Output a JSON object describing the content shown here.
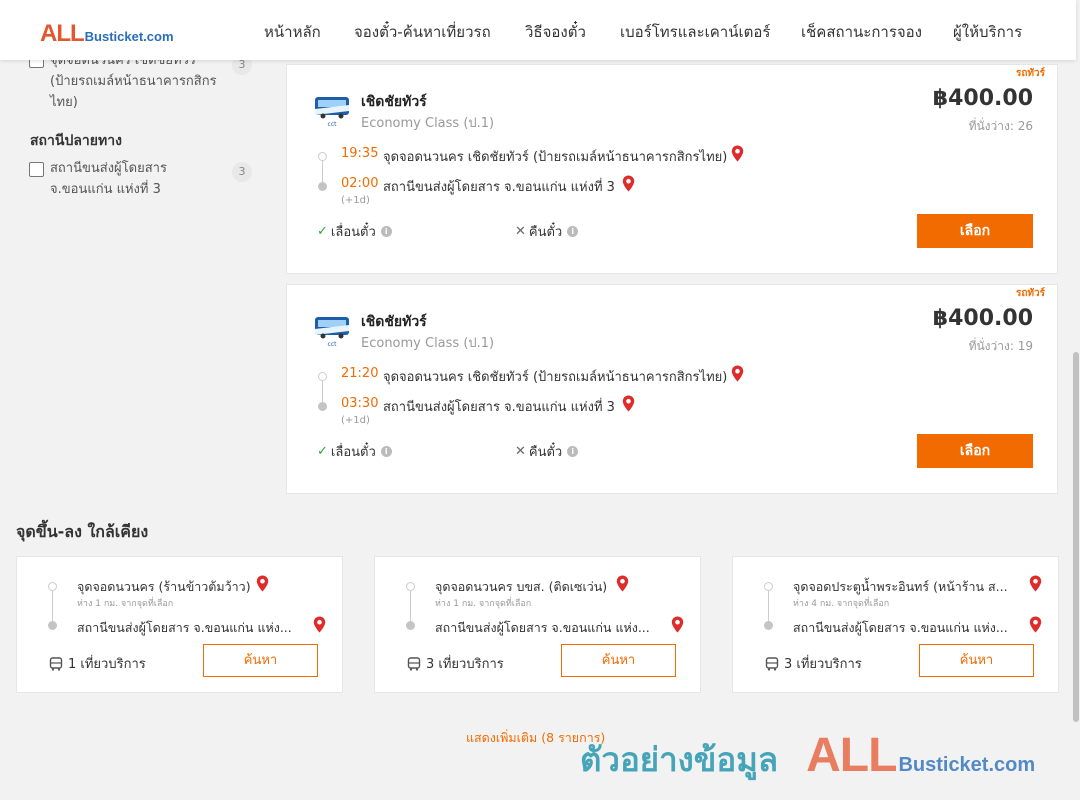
{
  "header": {
    "logo_all": "ALL",
    "logo_rest": "Busticket.com",
    "nav": [
      "หน้าหลัก",
      "จองตั๋ว-ค้นหาเที่ยวรถ",
      "วิธีจองตั๋ว",
      "เบอร์โทรและเคาน์เตอร์",
      "เช็คสถานะการจอง",
      "ผู้ให้บริการ"
    ]
  },
  "sidebar": {
    "origin_item": {
      "lines": [
        "จุดจอดนวนคร เชิดชัยทัวร์",
        "(ป้ายรถเมล์หน้าธนาคารกสิกร",
        "ไทย)"
      ],
      "count": "3"
    },
    "destination_heading": "สถานีปลายทาง",
    "destination_item": {
      "lines": [
        "สถานีขนส่งผู้โดยสาร",
        "จ.ขอนแก่น แห่งที่ 3"
      ],
      "count": "3"
    }
  },
  "results": [
    {
      "tag": "รถทัวร์",
      "operator": "เชิดชัยทัวร์",
      "bus_class": "Economy Class (ป.1)",
      "price": "฿400.00",
      "seats": "ที่นั่งว่าง: 26",
      "depart_time": "19:35",
      "depart_place": "จุดจอดนวนคร เชิดชัยทัวร์ (ป้ายรถเมล์หน้าธนาคารกสิกรไทย)",
      "arrive_time": "02:00",
      "arrive_place": "สถานีขนส่งผู้โดยสาร จ.ขอนแก่น แห่งที่ 3",
      "next_day": "(+1d)",
      "reschedule": "เลื่อนตั๋ว",
      "refund": "คืนตั๋ว",
      "select_label": "เลือก"
    },
    {
      "tag": "รถทัวร์",
      "operator": "เชิดชัยทัวร์",
      "bus_class": "Economy Class (ป.1)",
      "price": "฿400.00",
      "seats": "ที่นั่งว่าง: 19",
      "depart_time": "21:20",
      "depart_place": "จุดจอดนวนคร เชิดชัยทัวร์ (ป้ายรถเมล์หน้าธนาคารกสิกรไทย)",
      "arrive_time": "03:30",
      "arrive_place": "สถานีขนส่งผู้โดยสาร จ.ขอนแก่น แห่งที่ 3",
      "next_day": "(+1d)",
      "reschedule": "เลื่อนตั๋ว",
      "refund": "คืนตั๋ว",
      "select_label": "เลือก"
    }
  ],
  "nearby": {
    "title": "จุดขึ้น-ลง ใกล้เคียง",
    "items": [
      {
        "name": "จุดจอดนวนคร (ร้านข้าวต้มว้าว)",
        "distance": "ห่าง 1 กม. จากจุดที่เลือก",
        "destination": "สถานีขนส่งผู้โดยสาร จ.ขอนแก่น แห่ง...",
        "trips": "1 เที่ยวบริการ",
        "button": "ค้นหา"
      },
      {
        "name": "จุดจอดนวนคร บขส. (ติดเซเว่น)",
        "distance": "ห่าง 1 กม. จากจุดที่เลือก",
        "destination": "สถานีขนส่งผู้โดยสาร จ.ขอนแก่น แห่ง...",
        "trips": "3 เที่ยวบริการ",
        "button": "ค้นหา"
      },
      {
        "name": "จุดจอดประตูน้ำพระอินทร์ (หน้าร้าน ส...",
        "distance": "ห่าง 4 กม. จากจุดที่เลือก",
        "destination": "สถานีขนส่งผู้โดยสาร จ.ขอนแก่น แห่ง...",
        "trips": "3 เที่ยวบริการ",
        "button": "ค้นหา"
      }
    ],
    "show_more": "แสดงเพิ่มเติม (8 รายการ)"
  },
  "watermark": {
    "thai": "ตัวอย่างข้อมูล",
    "all": "ALL",
    "rest": "Busticket.com"
  },
  "colors": {
    "accent": "#f26b00",
    "brand_red": "#e4572e",
    "brand_blue": "#2a6ebb",
    "ok_green": "#2ea52e"
  }
}
